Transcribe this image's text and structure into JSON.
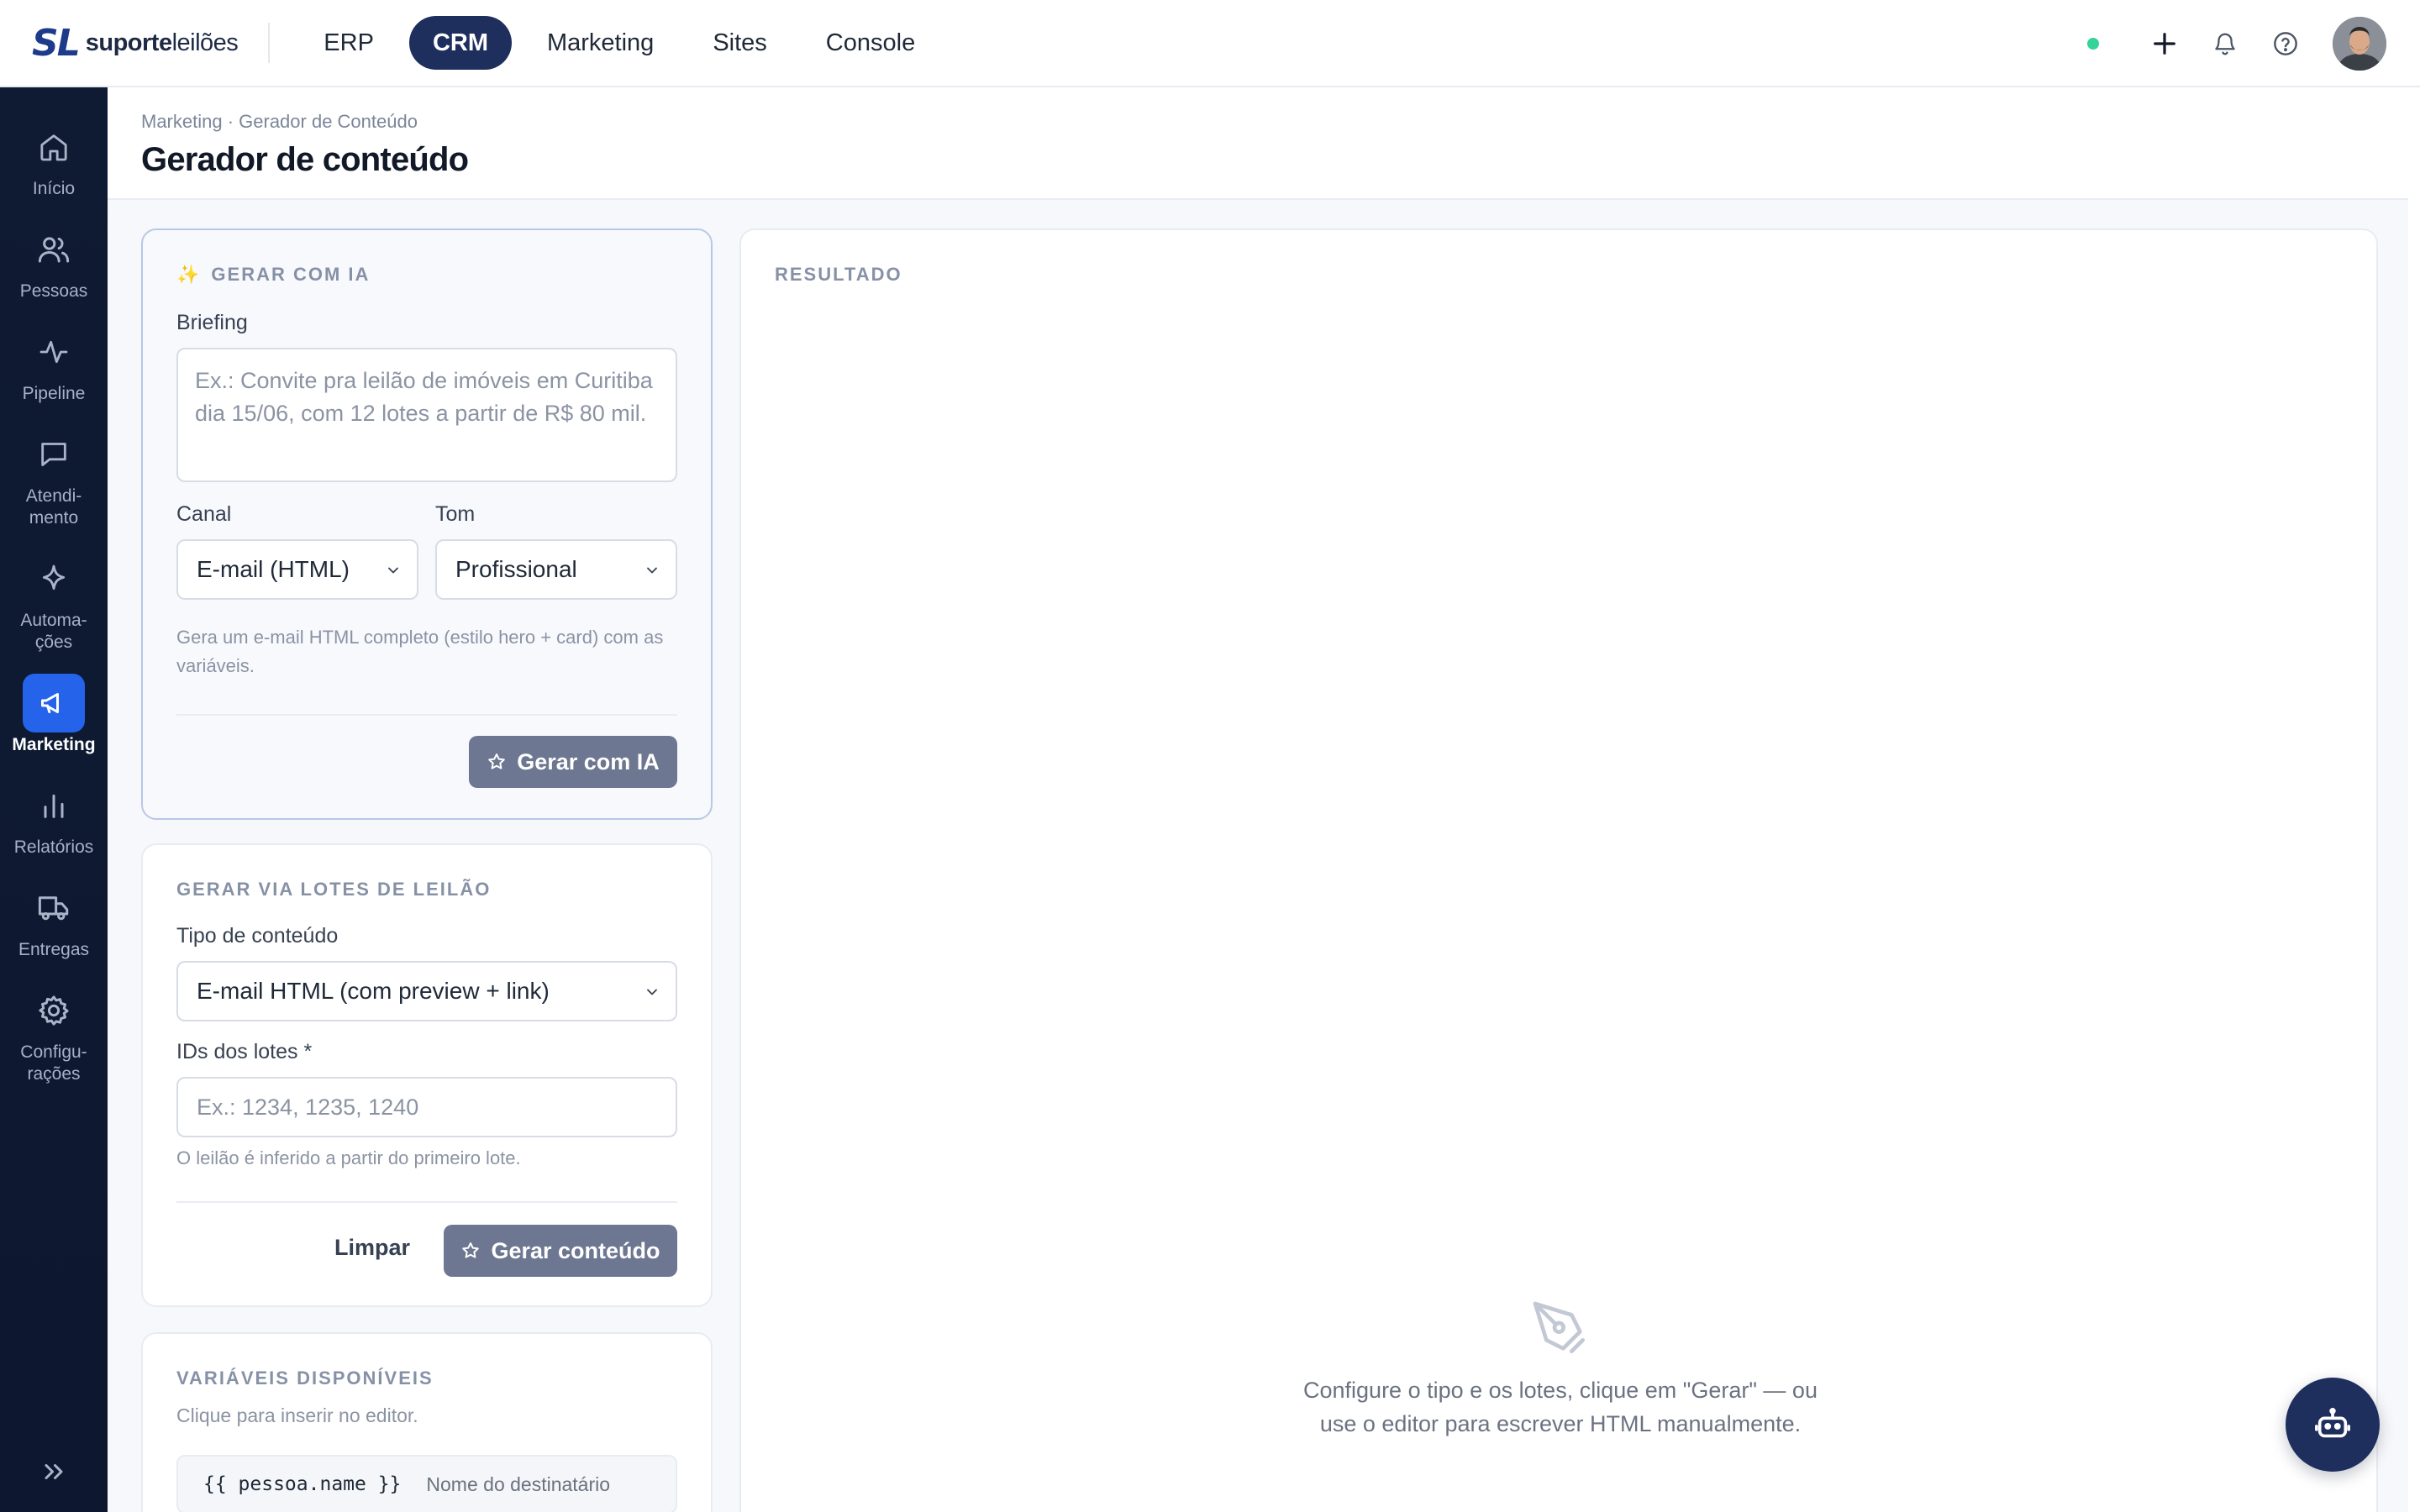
{
  "brand": {
    "mark": "SL",
    "name_strong": "suporte",
    "name_light": "leilões"
  },
  "top_nav": [
    {
      "label": "ERP",
      "active": false
    },
    {
      "label": "CRM",
      "active": true
    },
    {
      "label": "Marketing",
      "active": false
    },
    {
      "label": "Sites",
      "active": false
    },
    {
      "label": "Console",
      "active": false
    }
  ],
  "sidebar": {
    "items": [
      {
        "label": "Início",
        "icon": "home-icon"
      },
      {
        "label": "Pessoas",
        "icon": "users-icon"
      },
      {
        "label": "Pipeline",
        "icon": "activity-icon"
      },
      {
        "label": "Atendi-\nmento",
        "icon": "chat-icon"
      },
      {
        "label": "Automa-\nções",
        "icon": "sparkle-icon"
      },
      {
        "label": "Marketing",
        "icon": "megaphone-icon",
        "active": true
      },
      {
        "label": "Relatórios",
        "icon": "bar-chart-icon"
      },
      {
        "label": "Entregas",
        "icon": "truck-icon"
      },
      {
        "label": "Configu-\nrações",
        "icon": "gear-icon"
      }
    ]
  },
  "header": {
    "breadcrumb": "Marketing · Gerador de Conteúdo",
    "title": "Gerador de conteúdo"
  },
  "ai_card": {
    "title_icon": "✨",
    "title": "GERAR COM IA",
    "briefing_label": "Briefing",
    "briefing_placeholder": "Ex.: Convite pra leilão de imóveis em Curitiba dia 15/06, com 12 lotes a partir de R$ 80 mil.",
    "channel_label": "Canal",
    "channel_value": "E-mail (HTML)",
    "tone_label": "Tom",
    "tone_value": "Profissional",
    "hint": "Gera um e-mail HTML completo (estilo hero + card) com as variáveis.",
    "button": "Gerar com IA"
  },
  "lots_card": {
    "title": "GERAR VIA LOTES DE LEILÃO",
    "type_label": "Tipo de conteúdo",
    "type_value": "E-mail HTML (com preview + link)",
    "ids_label": "IDs dos lotes *",
    "ids_placeholder": "Ex.: 1234, 1235, 1240",
    "hint": "O leilão é inferido a partir do primeiro lote.",
    "clear_button": "Limpar",
    "generate_button": "Gerar conteúdo"
  },
  "vars_card": {
    "title": "VARIÁVEIS DISPONÍVEIS",
    "subtitle": "Clique para inserir no editor.",
    "items": [
      {
        "code": "{{ pessoa.name }}",
        "desc": "Nome do destinatário"
      }
    ]
  },
  "result": {
    "title": "RESULTADO",
    "empty_line1": "Configure o tipo e os lotes, clique em \"Gerar\" — ou",
    "empty_line2": "use o editor para escrever HTML manualmente."
  },
  "colors": {
    "accent": "#2563eb",
    "navy": "#1e2f5e",
    "sidebar": "#0f1a33",
    "status": "#34d399"
  }
}
